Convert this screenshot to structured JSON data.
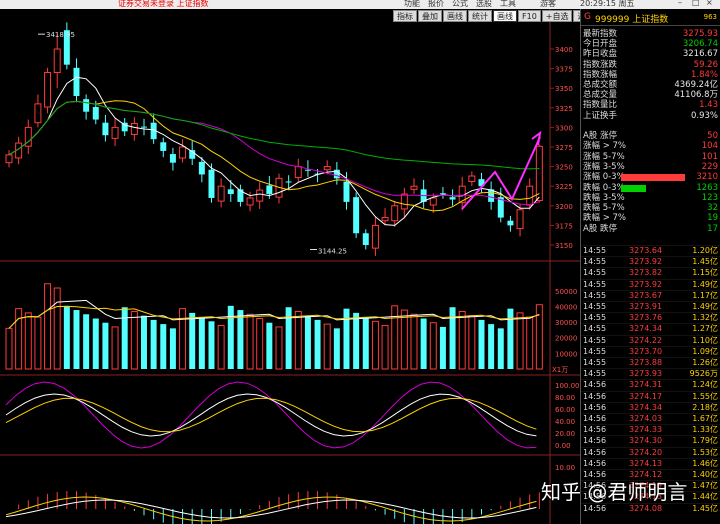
{
  "topbar": {
    "warning": "证券交易未登录  上证指数",
    "menu": [
      "功能",
      "报价",
      "公式",
      "选股",
      "工具"
    ],
    "menu_extra": "游客",
    "clock": "20:29:15 周五",
    "win_buttons": [
      "–",
      "□",
      "×"
    ]
  },
  "toolbar": [
    "指标",
    "叠加",
    "画线",
    "统计",
    "画线",
    "F10",
    "+自选",
    "返回"
  ],
  "toolbar_active": 4,
  "quote": {
    "g_label": "G",
    "code_name": "999999 上证指数",
    "tag": "963",
    "rows": [
      {
        "label": "最新指数",
        "value": "3275.93",
        "color": "red"
      },
      {
        "label": "今日开盘",
        "value": "3206.74",
        "color": "green"
      },
      {
        "label": "昨日收盘",
        "value": "3216.67",
        "color": "white"
      },
      {
        "label": "指数涨跌",
        "value": "59.26",
        "color": "red"
      },
      {
        "label": "指数涨幅",
        "value": "1.84%",
        "color": "red"
      },
      {
        "label": "总成交额",
        "value": "4369.24亿",
        "color": "white"
      },
      {
        "label": "总成交量",
        "value": "41106.8万",
        "color": "white"
      },
      {
        "label": "指数量比",
        "value": "1.43",
        "color": "red"
      },
      {
        "label": "上证换手",
        "value": "0.93%",
        "color": "white"
      }
    ]
  },
  "breadth": [
    {
      "label": "A股 涨停",
      "value": "50",
      "color": "red",
      "bar": 0
    },
    {
      "label": "涨幅 > 7%",
      "value": "104",
      "color": "red",
      "bar": 0
    },
    {
      "label": "涨幅 5-7%",
      "value": "101",
      "color": "red",
      "bar": 0
    },
    {
      "label": "涨幅 3-5%",
      "value": "229",
      "color": "red",
      "bar": 0
    },
    {
      "label": "涨幅 0-3%",
      "value": "3210",
      "color": "red",
      "bar": 0.97
    },
    {
      "label": "跌幅 0-3%",
      "value": "1263",
      "color": "green",
      "bar": 0.38
    },
    {
      "label": "跌幅 3-5%",
      "value": "123",
      "color": "green",
      "bar": 0
    },
    {
      "label": "跌幅 5-7%",
      "value": "32",
      "color": "green",
      "bar": 0
    },
    {
      "label": "跌幅 > 7%",
      "value": "19",
      "color": "green",
      "bar": 0
    },
    {
      "label": "A股 跌停",
      "value": "17",
      "color": "green",
      "bar": 0
    }
  ],
  "ticks": [
    {
      "time": "14:55",
      "price": "3273.64",
      "vol": "1.20亿"
    },
    {
      "time": "14:55",
      "price": "3273.92",
      "vol": "1.45亿"
    },
    {
      "time": "14:55",
      "price": "3273.82",
      "vol": "1.15亿"
    },
    {
      "time": "14:55",
      "price": "3273.92",
      "vol": "1.49亿"
    },
    {
      "time": "14:55",
      "price": "3273.67",
      "vol": "1.17亿"
    },
    {
      "time": "14:55",
      "price": "3273.91",
      "vol": "1.49亿"
    },
    {
      "time": "14:55",
      "price": "3273.76",
      "vol": "1.32亿"
    },
    {
      "time": "14:55",
      "price": "3274.34",
      "vol": "1.27亿"
    },
    {
      "time": "14:55",
      "price": "3274.22",
      "vol": "1.10亿"
    },
    {
      "time": "14:55",
      "price": "3273.70",
      "vol": "1.09亿"
    },
    {
      "time": "14:55",
      "price": "3273.88",
      "vol": "1.26亿"
    },
    {
      "time": "14:55",
      "price": "3273.93",
      "vol": "9526万"
    },
    {
      "time": "14:56",
      "price": "3274.31",
      "vol": "1.24亿"
    },
    {
      "time": "14:56",
      "price": "3274.17",
      "vol": "1.55亿"
    },
    {
      "time": "14:56",
      "price": "3274.34",
      "vol": "2.18亿"
    },
    {
      "time": "14:56",
      "price": "3274.03",
      "vol": "1.67亿"
    },
    {
      "time": "14:56",
      "price": "3274.33",
      "vol": "1.33亿"
    },
    {
      "time": "14:56",
      "price": "3274.30",
      "vol": "1.79亿"
    },
    {
      "time": "14:56",
      "price": "3274.20",
      "vol": "1.53亿"
    },
    {
      "time": "14:56",
      "price": "3274.13",
      "vol": "1.46亿"
    },
    {
      "time": "14:56",
      "price": "3274.12",
      "vol": "1.40亿"
    },
    {
      "time": "14:56",
      "price": "3274.19",
      "vol": "1.47亿"
    },
    {
      "time": "14:56",
      "price": "3274.13",
      "vol": "1.44亿"
    },
    {
      "time": "14:56",
      "price": "3274.08",
      "vol": "1.45亿"
    }
  ],
  "price_axis": {
    "labels": [
      "3400",
      "3375",
      "3350",
      "3325",
      "3300",
      "3275",
      "3250",
      "3225",
      "3200",
      "3175",
      "3150"
    ],
    "max_label": "3418.95",
    "min_label": "3144.25"
  },
  "volume_axis": {
    "labels": [
      "50000",
      "40000",
      "30000",
      "20000",
      "10000"
    ],
    "unit": "X1万"
  },
  "ind1_axis": [
    "100.00",
    "80.00",
    "60.00",
    "40.00",
    "20.00",
    "0.00"
  ],
  "ind2_axis": [
    "10.00"
  ],
  "watermark": "知乎 @君师明言",
  "colors": {
    "up": "#ff3b3b",
    "down": "#54ffff",
    "ma5": "#ffffff",
    "ma10": "#ffd200",
    "ma20": "#d000d0",
    "ma60": "#00b000"
  }
}
